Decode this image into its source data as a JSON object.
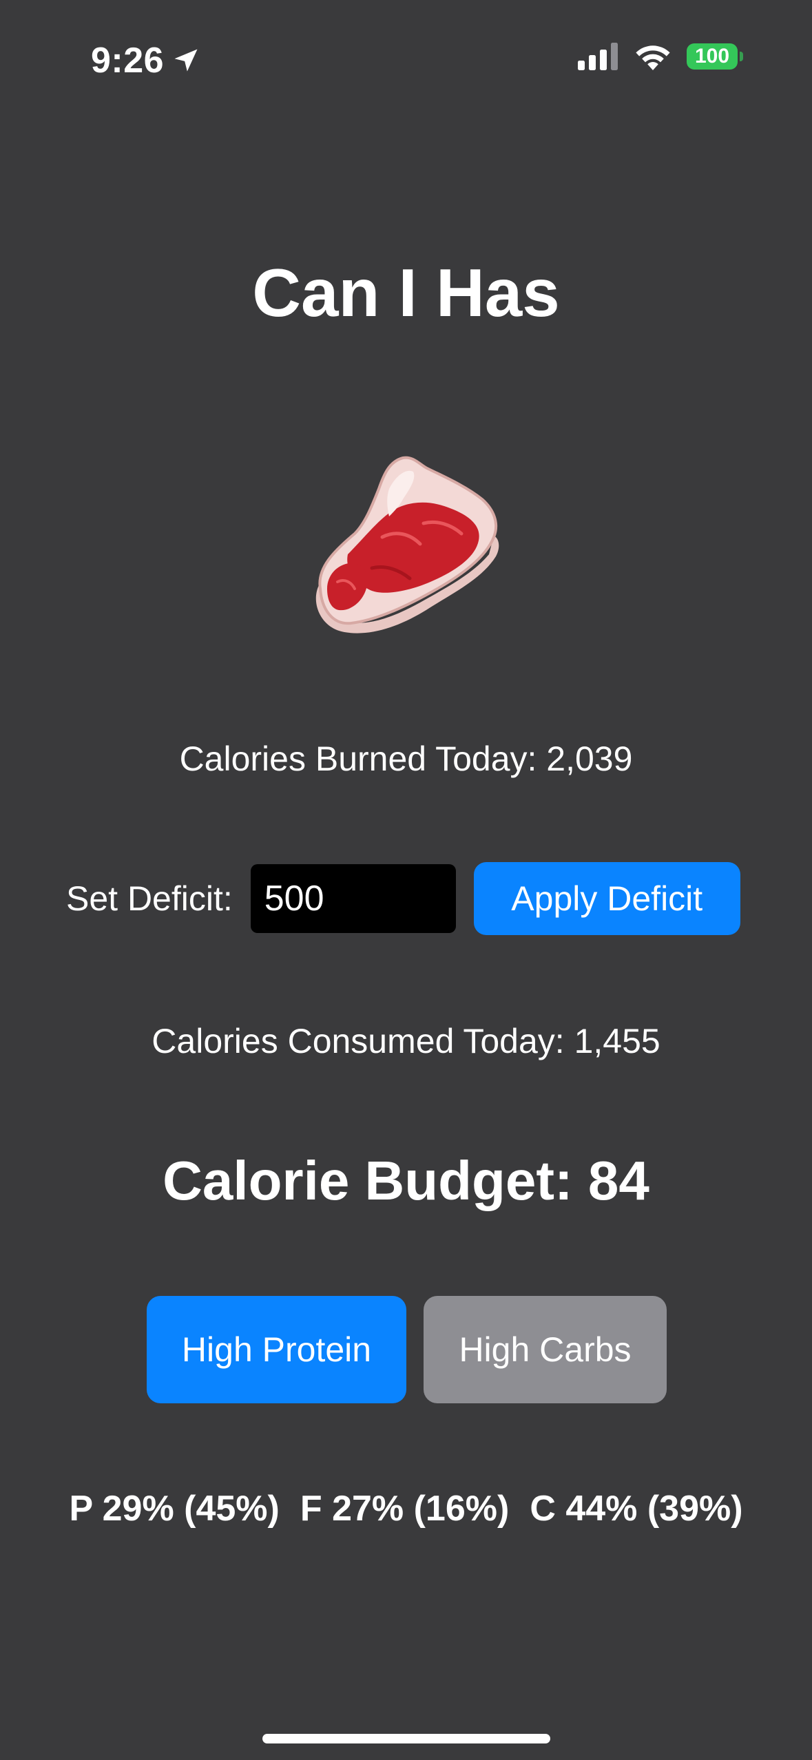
{
  "status_bar": {
    "time": "9:26",
    "battery_level": "100",
    "icons": [
      "location-arrow-icon",
      "cellular-signal-icon",
      "wifi-icon",
      "battery-icon"
    ],
    "battery_color": "#34c759"
  },
  "app": {
    "title": "Can I Has",
    "hero_icon": "steak-icon"
  },
  "burned": {
    "text": "Calories Burned Today: 2,039"
  },
  "deficit": {
    "label": "Set Deficit:",
    "value": "500",
    "button_label": "Apply Deficit"
  },
  "consumed": {
    "text": "Calories Consumed Today: 1,455"
  },
  "budget": {
    "text": "Calorie Budget: 84"
  },
  "modes": {
    "high_protein_label": "High Protein",
    "high_carbs_label": "High Carbs",
    "selected": "High Protein"
  },
  "macros": {
    "protein": "P 29% (45%)",
    "fat": "F 27% (16%)",
    "carbs": "C 44% (39%)"
  },
  "colors": {
    "background": "#3a3a3c",
    "accent": "#0a84ff",
    "inactive_button": "#8e8e93",
    "input_background": "#000000"
  }
}
